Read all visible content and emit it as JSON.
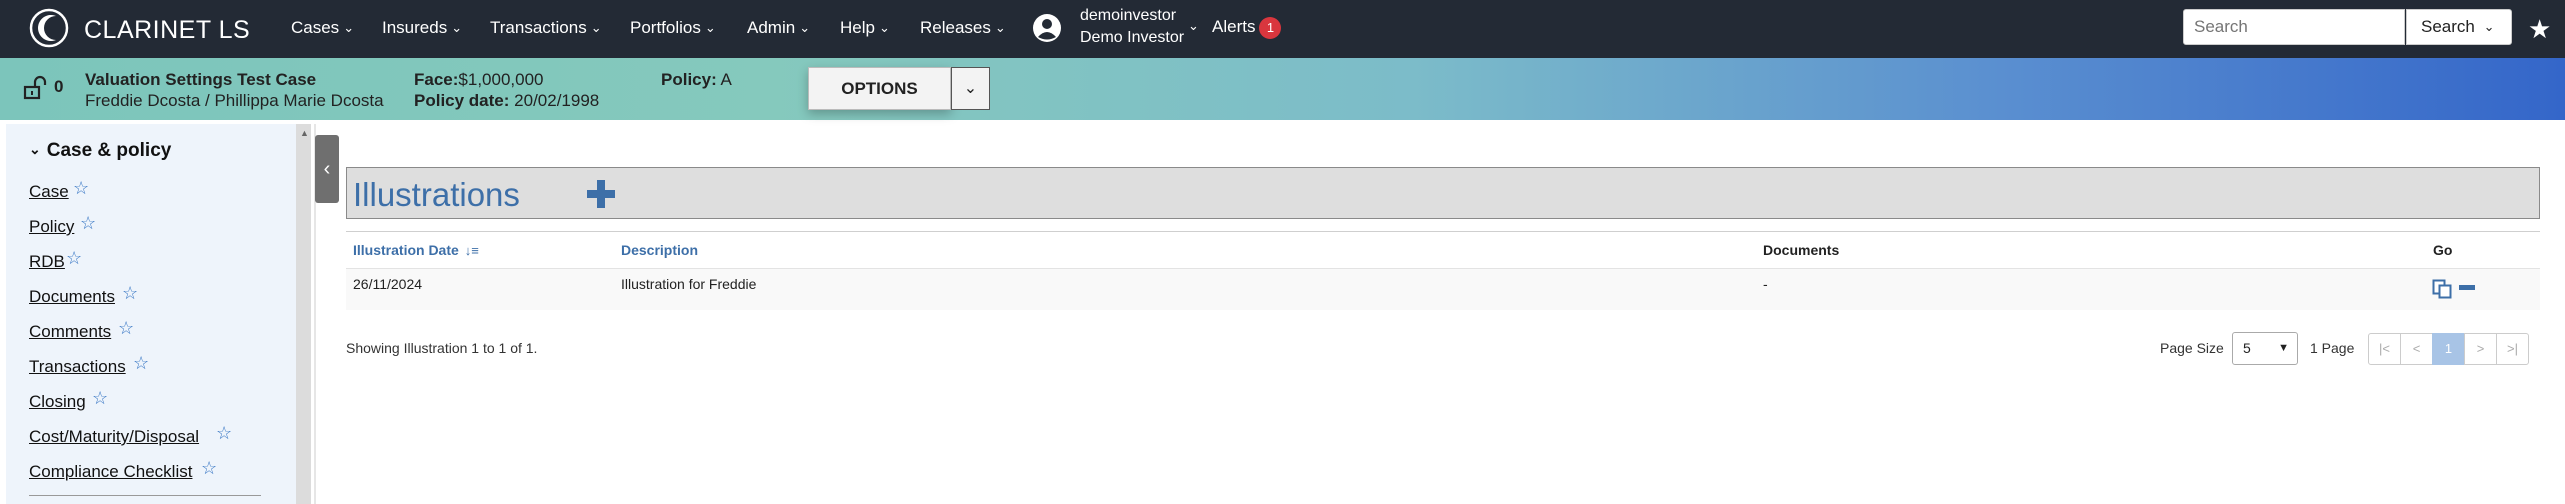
{
  "navbar": {
    "brand": "CLARINET LS",
    "menu": [
      {
        "label": "Cases"
      },
      {
        "label": "Insureds"
      },
      {
        "label": "Transactions"
      },
      {
        "label": "Portfolios"
      },
      {
        "label": "Admin"
      },
      {
        "label": "Help"
      },
      {
        "label": "Releases"
      }
    ],
    "user": {
      "username": "demoinvestor",
      "display_name": "Demo Investor"
    },
    "alerts": {
      "label": "Alerts",
      "count": "1"
    },
    "search": {
      "placeholder": "Search",
      "button_label": "Search"
    },
    "icons": {
      "logo": "clarinet-logo-icon",
      "user": "user-circle-icon",
      "favorite": "star-icon"
    }
  },
  "case_banner": {
    "lock_count": "0",
    "case_name": "Valuation Settings Test Case",
    "insureds": "Freddie Dcosta / Phillippa Marie Dcosta",
    "face_label": "Face:",
    "face_value": "$1,000,000",
    "policy_label": "Policy:",
    "policy_value": "A",
    "policy_date_label": "Policy date:",
    "policy_date_value": "20/02/1998",
    "options_label": "OPTIONS"
  },
  "sidebar": {
    "section_title": "Case & policy",
    "items": [
      {
        "label": "Case"
      },
      {
        "label": "Policy"
      },
      {
        "label": "RDB"
      },
      {
        "label": "Documents"
      },
      {
        "label": "Comments"
      },
      {
        "label": "Transactions"
      },
      {
        "label": "Closing"
      },
      {
        "label": "Cost/Maturity/Disposal"
      },
      {
        "label": "Compliance Checklist"
      }
    ]
  },
  "illustrations": {
    "title": "Illustrations",
    "columns": {
      "date": "Illustration Date",
      "description": "Description",
      "documents": "Documents",
      "go": "Go"
    },
    "rows": [
      {
        "date": "26/11/2024",
        "description": "Illustration for Freddie",
        "documents": "-"
      }
    ],
    "showing_text": "Showing Illustration 1 to 1 of 1.",
    "page_size_label": "Page Size",
    "page_size_value": "5",
    "page_count": "1 Page",
    "pager": {
      "first": "|<",
      "prev": "<",
      "current": "1",
      "next": ">",
      "last": ">|"
    }
  },
  "colors": {
    "navbar_bg": "#232a35",
    "accent_blue": "#3d6fa8",
    "alert_badge": "#d9363e",
    "banner_gradient_start": "#7cc5bb",
    "banner_gradient_end": "#3466c9"
  }
}
